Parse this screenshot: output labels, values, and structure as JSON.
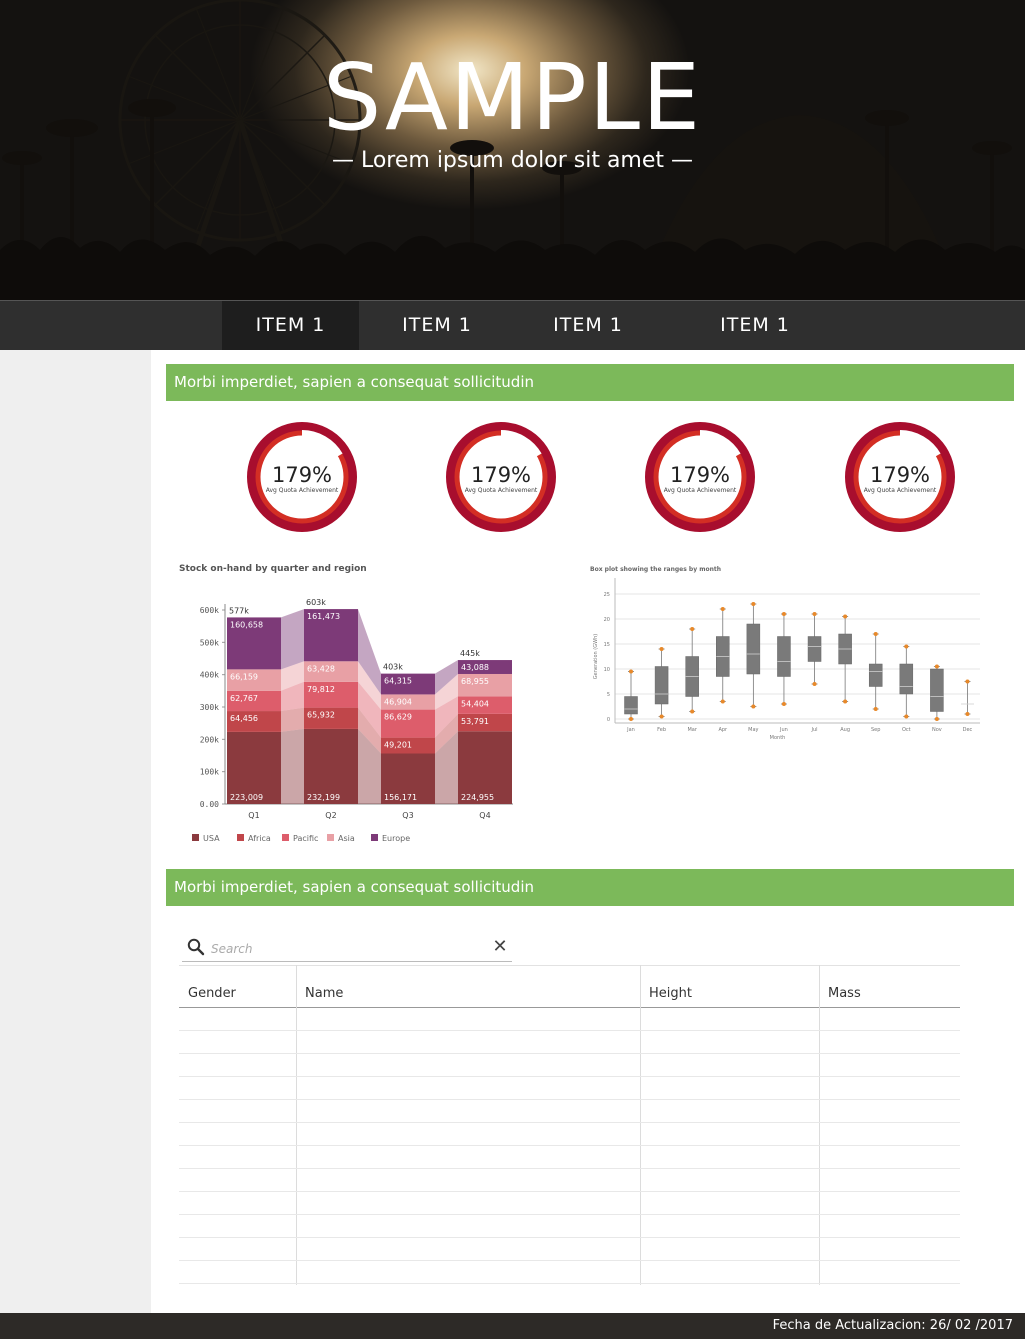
{
  "hero": {
    "title": "SAMPLE",
    "subtitle": "— Lorem ipsum dolor sit amet —"
  },
  "nav": {
    "items": [
      {
        "label": "ITEM 1",
        "active": true
      },
      {
        "label": "ITEM 1",
        "active": false
      },
      {
        "label": "ITEM 1",
        "active": false
      },
      {
        "label": "ITEM 1",
        "active": false
      }
    ]
  },
  "sections": [
    {
      "title": "Morbi imperdiet, sapien a consequat sollicitudin"
    },
    {
      "title": "Morbi imperdiet, sapien a consequat sollicitudin"
    }
  ],
  "gauges": [
    {
      "value": "179%",
      "label": "Avg Quota Achievement"
    },
    {
      "value": "179%",
      "label": "Avg Quota Achievement"
    },
    {
      "value": "179%",
      "label": "Avg Quota Achievement"
    },
    {
      "value": "179%",
      "label": "Avg Quota Achievement"
    }
  ],
  "colors": {
    "accent_green": "#7cb95a",
    "gauge_red": "#d32e24",
    "gauge_dark": "#a80e2e",
    "nav_bg": "#2f2f2f"
  },
  "chart_data": [
    {
      "type": "bar",
      "title": "Stock on-hand by quarter and region",
      "categories": [
        "Q1",
        "Q2",
        "Q3",
        "Q4"
      ],
      "totals": [
        "577k",
        "603k",
        "403k",
        "445k"
      ],
      "ytick_labels": [
        "0.00",
        "100k",
        "200k",
        "300k",
        "400k",
        "500k",
        "600k"
      ],
      "ylim": [
        0,
        600000
      ],
      "legend_position": "bottom-left",
      "series": [
        {
          "name": "USA",
          "color": "#8b3a3e",
          "values": [
            223009,
            232199,
            156171,
            224955
          ],
          "labels": [
            "223,009",
            "232,199",
            "156,171",
            "224,955"
          ]
        },
        {
          "name": "Africa",
          "color": "#c0464a",
          "values": [
            64456,
            65932,
            49201,
            53791
          ],
          "labels": [
            "64,456",
            "65,932",
            "49,201",
            "53,791"
          ]
        },
        {
          "name": "Pacific",
          "color": "#dd5d6b",
          "values": [
            62767,
            79812,
            86629,
            54404
          ],
          "labels": [
            "62,767",
            "79,812",
            "86,629",
            "54,404"
          ]
        },
        {
          "name": "Asia",
          "color": "#e8a0a5",
          "values": [
            66159,
            63428,
            46904,
            68955
          ],
          "labels": [
            "66,159",
            "63,428",
            "46,904",
            "68,955"
          ]
        },
        {
          "name": "Europe",
          "color": "#7d3a78",
          "values": [
            160658,
            161473,
            64315,
            43088
          ],
          "labels": [
            "160,658",
            "161,473",
            "64,315",
            "43,088"
          ]
        }
      ]
    },
    {
      "type": "box",
      "title": "Box plot showing the ranges by month",
      "xlabel": "Month",
      "ylabel": "Generation (GWh)",
      "ytick_labels": [
        "0",
        "5",
        "10",
        "15",
        "20",
        "25"
      ],
      "ylim": [
        0,
        25
      ],
      "categories": [
        "Jan",
        "Feb",
        "Mar",
        "Apr",
        "May",
        "Jun",
        "Jul",
        "Aug",
        "Sep",
        "Oct",
        "Nov",
        "Dec"
      ],
      "boxes": [
        {
          "min": 0,
          "q1": 1,
          "median": 2,
          "q3": 4.5,
          "max": 9.5
        },
        {
          "min": 0.5,
          "q1": 3,
          "median": 5,
          "q3": 10.5,
          "max": 14
        },
        {
          "min": 1.5,
          "q1": 4.5,
          "median": 8.5,
          "q3": 12.5,
          "max": 18
        },
        {
          "min": 3.5,
          "q1": 8.5,
          "median": 12.5,
          "q3": 16.5,
          "max": 22
        },
        {
          "min": 2.5,
          "q1": 9,
          "median": 13,
          "q3": 19,
          "max": 23
        },
        {
          "min": 3,
          "q1": 8.5,
          "median": 11.5,
          "q3": 16.5,
          "max": 21
        },
        {
          "min": 7,
          "q1": 11.5,
          "median": 14.5,
          "q3": 16.5,
          "max": 21
        },
        {
          "min": 3.5,
          "q1": 11,
          "median": 14,
          "q3": 17,
          "max": 20.5
        },
        {
          "min": 2,
          "q1": 6.5,
          "median": 9.5,
          "q3": 11,
          "max": 17
        },
        {
          "min": 0.5,
          "q1": 5,
          "median": 6.5,
          "q3": 11,
          "max": 14.5
        },
        {
          "min": 0,
          "q1": 1.5,
          "median": 4.5,
          "q3": 10,
          "max": 10.5
        },
        {
          "min": 1,
          "q1": 3,
          "median": 3,
          "q3": 3,
          "max": 7.5
        }
      ],
      "outlier_color": "#e8892a"
    }
  ],
  "table": {
    "search_placeholder": "Search",
    "columns": [
      "Gender",
      "Name",
      "Height",
      "Mass"
    ],
    "rows": [
      [
        "",
        "",
        "",
        ""
      ],
      [
        "",
        "",
        "",
        ""
      ],
      [
        "",
        "",
        "",
        ""
      ],
      [
        "",
        "",
        "",
        ""
      ],
      [
        "",
        "",
        "",
        ""
      ],
      [
        "",
        "",
        "",
        ""
      ],
      [
        "",
        "",
        "",
        ""
      ],
      [
        "",
        "",
        "",
        ""
      ],
      [
        "",
        "",
        "",
        ""
      ],
      [
        "",
        "",
        "",
        ""
      ],
      [
        "",
        "",
        "",
        ""
      ],
      [
        "",
        "",
        "",
        ""
      ]
    ]
  },
  "footer": {
    "text": "Fecha de Actualizacion: 26/ 02 /2017"
  }
}
